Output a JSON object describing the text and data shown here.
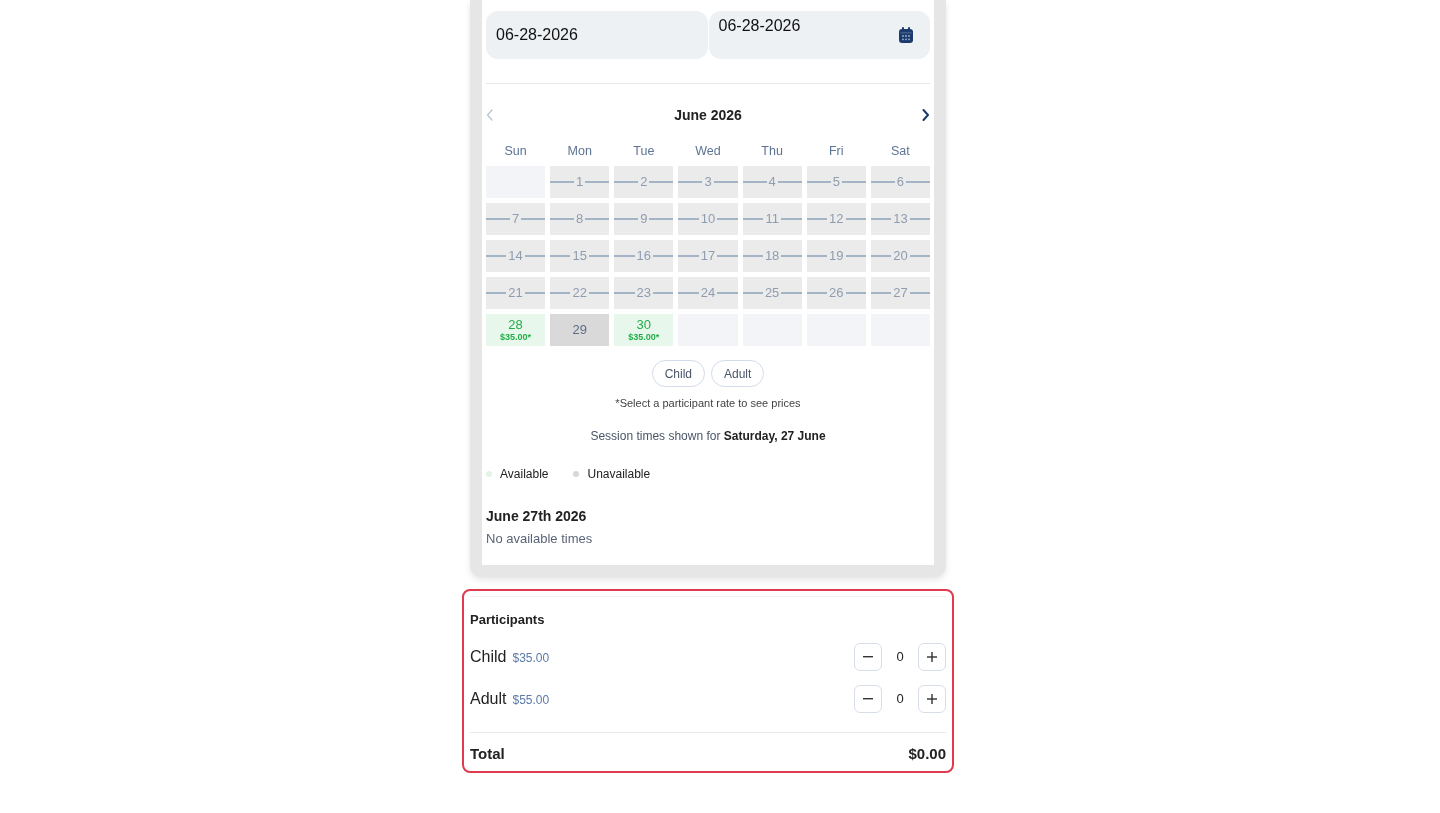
{
  "date_range": {
    "start": {
      "value": "06-28-2026"
    },
    "end": {
      "value": "06-28-2026"
    }
  },
  "calendar": {
    "month_label": "June 2026",
    "previous": {
      "disabled": true
    },
    "next": {
      "disabled": false
    },
    "weekdays": [
      "Sun",
      "Mon",
      "Tue",
      "Wed",
      "Thu",
      "Fri",
      "Sat"
    ],
    "weeks": [
      [
        {
          "kind": "blank"
        },
        {
          "kind": "unavailable",
          "day": "1"
        },
        {
          "kind": "unavailable",
          "day": "2"
        },
        {
          "kind": "unavailable",
          "day": "3"
        },
        {
          "kind": "unavailable",
          "day": "4"
        },
        {
          "kind": "unavailable",
          "day": "5"
        },
        {
          "kind": "unavailable",
          "day": "6"
        }
      ],
      [
        {
          "kind": "unavailable",
          "day": "7"
        },
        {
          "kind": "unavailable",
          "day": "8"
        },
        {
          "kind": "unavailable",
          "day": "9"
        },
        {
          "kind": "unavailable",
          "day": "10"
        },
        {
          "kind": "unavailable",
          "day": "11"
        },
        {
          "kind": "unavailable",
          "day": "12"
        },
        {
          "kind": "unavailable",
          "day": "13"
        }
      ],
      [
        {
          "kind": "unavailable",
          "day": "14"
        },
        {
          "kind": "unavailable",
          "day": "15"
        },
        {
          "kind": "unavailable",
          "day": "16"
        },
        {
          "kind": "unavailable",
          "day": "17"
        },
        {
          "kind": "unavailable",
          "day": "18"
        },
        {
          "kind": "unavailable",
          "day": "19"
        },
        {
          "kind": "unavailable",
          "day": "20"
        }
      ],
      [
        {
          "kind": "unavailable",
          "day": "21"
        },
        {
          "kind": "unavailable",
          "day": "22"
        },
        {
          "kind": "unavailable",
          "day": "23"
        },
        {
          "kind": "unavailable",
          "day": "24"
        },
        {
          "kind": "unavailable",
          "day": "25"
        },
        {
          "kind": "unavailable",
          "day": "26"
        },
        {
          "kind": "unavailable",
          "day": "27"
        }
      ],
      [
        {
          "kind": "available",
          "day": "28",
          "price": "$35.00*"
        },
        {
          "kind": "plain",
          "day": "29"
        },
        {
          "kind": "available",
          "day": "30",
          "price": "$35.00*"
        },
        {
          "kind": "blank"
        },
        {
          "kind": "blank"
        },
        {
          "kind": "blank"
        },
        {
          "kind": "blank"
        }
      ]
    ]
  },
  "rates": [
    {
      "label": "Child",
      "selected": false
    },
    {
      "label": "Adult",
      "selected": false
    }
  ],
  "rate_note": "*Select a participant rate to see prices",
  "session_note": "Session times shown for **Saturday, 27 June**",
  "legend": [
    {
      "label": "Available",
      "color": "#e1f4e6"
    },
    {
      "label": "Unavailable",
      "color": "#d6d6d6"
    }
  ],
  "sessions": {
    "date": "June 27th 2026",
    "message": "No available times"
  },
  "participants": {
    "title": "Participants",
    "rows": [
      {
        "label": "Child",
        "price": "$35.00",
        "count": "0"
      },
      {
        "label": "Adult",
        "price": "$55.00",
        "count": "0"
      }
    ],
    "total_label": "Total",
    "total": "$0.00"
  }
}
